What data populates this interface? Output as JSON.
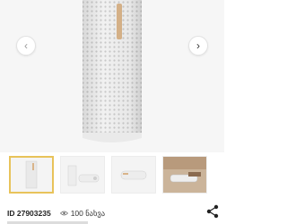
{
  "gallery": {
    "main_image": "white-cylindrical-dehumidifier",
    "prev_icon": "chevron-left-icon",
    "next_icon": "chevron-right-icon",
    "thumbnails": [
      {
        "name": "thumb-front-view",
        "active": true
      },
      {
        "name": "thumb-lying-pair",
        "active": false
      },
      {
        "name": "thumb-side-view",
        "active": false
      },
      {
        "name": "thumb-in-use",
        "active": false
      }
    ]
  },
  "meta": {
    "id_text": "ID 27903235",
    "views_text": "100 ნახვა",
    "share_icon": "share-icon"
  },
  "colors": {
    "accent_border": "#e8c35a",
    "wood_strip": "#d9b48a"
  }
}
